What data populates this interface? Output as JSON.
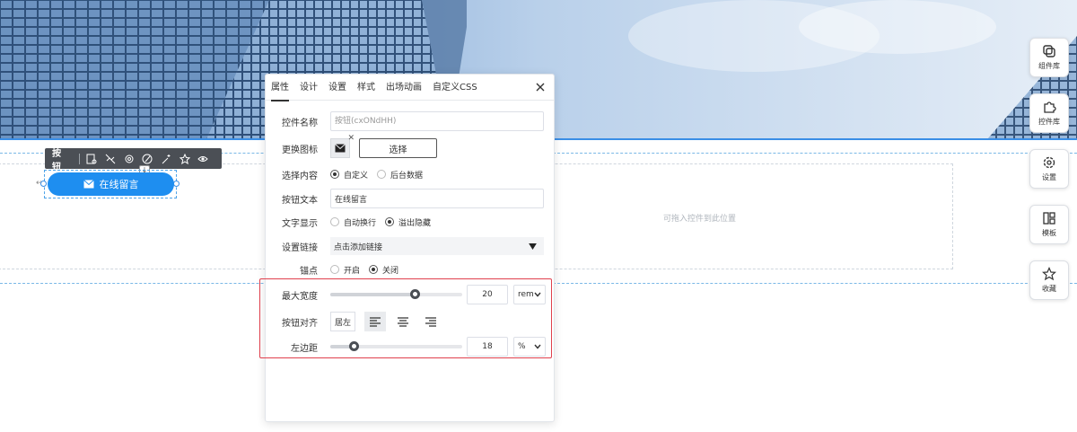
{
  "widget_toolbar": {
    "label": "按钮",
    "icons": [
      "style-icon",
      "unlink-icon",
      "settings-icon",
      "palette-icon",
      "magic-wand-icon",
      "star-icon",
      "eye-icon"
    ]
  },
  "canvas": {
    "online_button_label": "在线留言",
    "drop_hint": "可拖入控件到此位置"
  },
  "side_toolbar": [
    {
      "label": "组件库",
      "icon": "layers-icon"
    },
    {
      "label": "控件库",
      "icon": "puzzle-icon"
    },
    {
      "label": "设置",
      "icon": "gear-icon"
    },
    {
      "label": "模板",
      "icon": "template-icon"
    },
    {
      "label": "收藏",
      "icon": "star-icon"
    }
  ],
  "panel": {
    "tabs": [
      "属性",
      "设计",
      "设置",
      "样式",
      "出场动画",
      "自定义CSS"
    ],
    "active_tab": "属性",
    "control_name": {
      "label": "控件名称",
      "placeholder": "按钮(cxONdHH)"
    },
    "change_icon": {
      "label": "更换图标",
      "choose_label": "选择"
    },
    "select_content": {
      "label": "选择内容",
      "options": [
        "自定义",
        "后台数据"
      ],
      "selected": "自定义"
    },
    "button_text": {
      "label": "按钮文本",
      "value": "在线留言"
    },
    "text_display": {
      "label": "文字显示",
      "options": [
        "自动换行",
        "溢出隐藏"
      ],
      "selected": "溢出隐藏"
    },
    "set_link": {
      "label": "设置链接",
      "value": "点击添加链接"
    },
    "anchor": {
      "label": "锚点",
      "options": [
        "开启",
        "关闭"
      ],
      "selected": "关闭"
    },
    "max_width": {
      "label": "最大宽度",
      "value": "20",
      "unit": "rem",
      "slider_fraction": 0.64
    },
    "button_align": {
      "label": "按钮对齐",
      "value": "居左",
      "selected": "left"
    },
    "left_margin": {
      "label": "左边距",
      "value": "18",
      "unit": "%",
      "slider_fraction": 0.18
    }
  },
  "colors": {
    "accent": "#1e8ef0",
    "toolbar": "#4b4f55",
    "highlight": "#e0404d"
  }
}
